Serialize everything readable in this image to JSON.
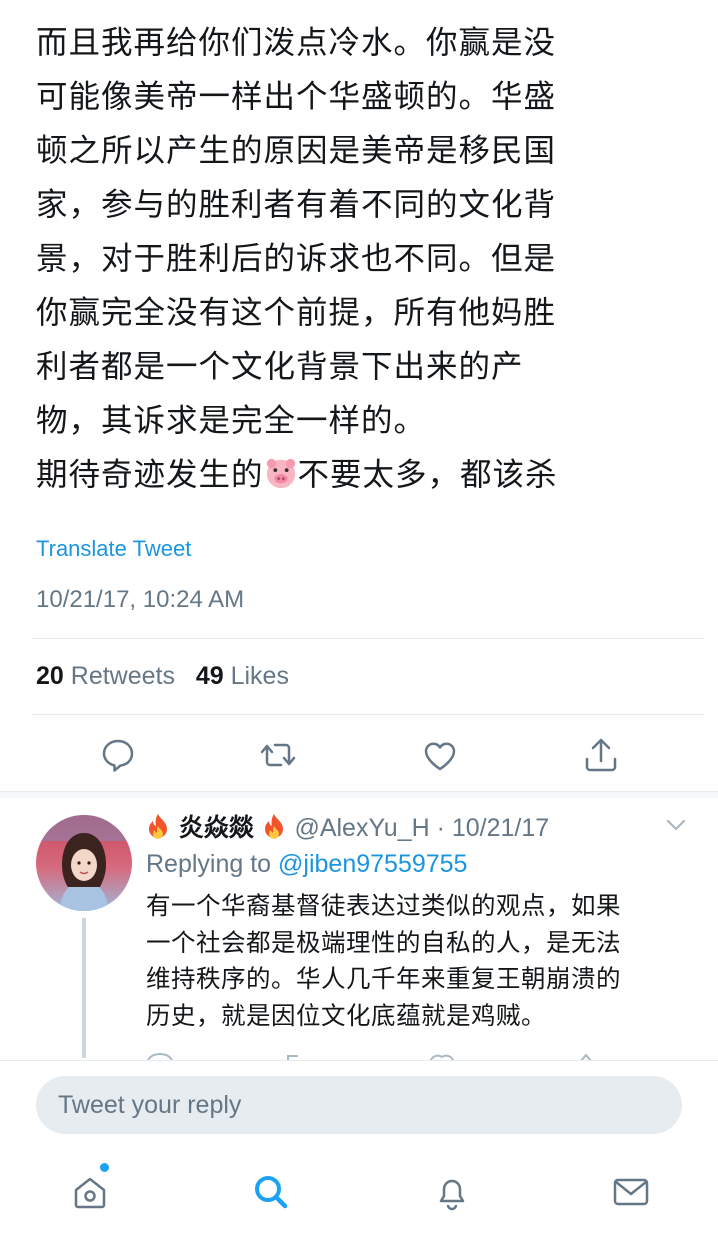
{
  "tweet": {
    "lines": [
      "而且我再给你们泼点冷水。你赢是没",
      "可能像美帝一样出个华盛顿的。华盛",
      "顿之所以产生的原因是美帝是移民国",
      "家，参与的胜利者有着不同的文化背",
      "景，对于胜利后的诉求也不同。但是",
      "你赢完全没有这个前提，所有他妈胜",
      "利者都是一个文化背景下出来的产",
      "物，其诉求是完全一样的。"
    ],
    "last_line_before": "期待奇迹发生的",
    "last_line_emoji": "pig-face-emoji",
    "last_line_after": "不要太多，都该杀",
    "translate": "Translate Tweet",
    "timestamp": "10/21/17, 10:24 AM",
    "retweets_count": "20",
    "retweets_label": "Retweets",
    "likes_count": "49",
    "likes_label": "Likes"
  },
  "actions": [
    "reply-icon",
    "retweet-icon",
    "like-icon",
    "share-icon"
  ],
  "reply": {
    "name_prefix_emoji": "🔥",
    "name": "炎焱燚",
    "name_suffix_emoji": "🔥",
    "handle_date": "@AlexYu_H · 10/21/17",
    "replying_label": "Replying to",
    "replying_to": "@jiben97559755",
    "lines": [
      "有一个华裔基督徒表达过类似的观点，如果",
      "一个社会都是极端理性的自私的人，是无法",
      "维持秩序的。华人几千年来重复王朝崩溃的",
      "历史，就是因位文化底蕴就是鸡贼。"
    ]
  },
  "compose": {
    "placeholder": "Tweet your reply"
  },
  "tabbar": [
    "home-icon",
    "search-icon",
    "notifications-icon",
    "messages-icon"
  ],
  "colors": {
    "accent": "#1da1f2",
    "link": "#1b95e0",
    "muted": "#657786",
    "text": "#14171a"
  }
}
